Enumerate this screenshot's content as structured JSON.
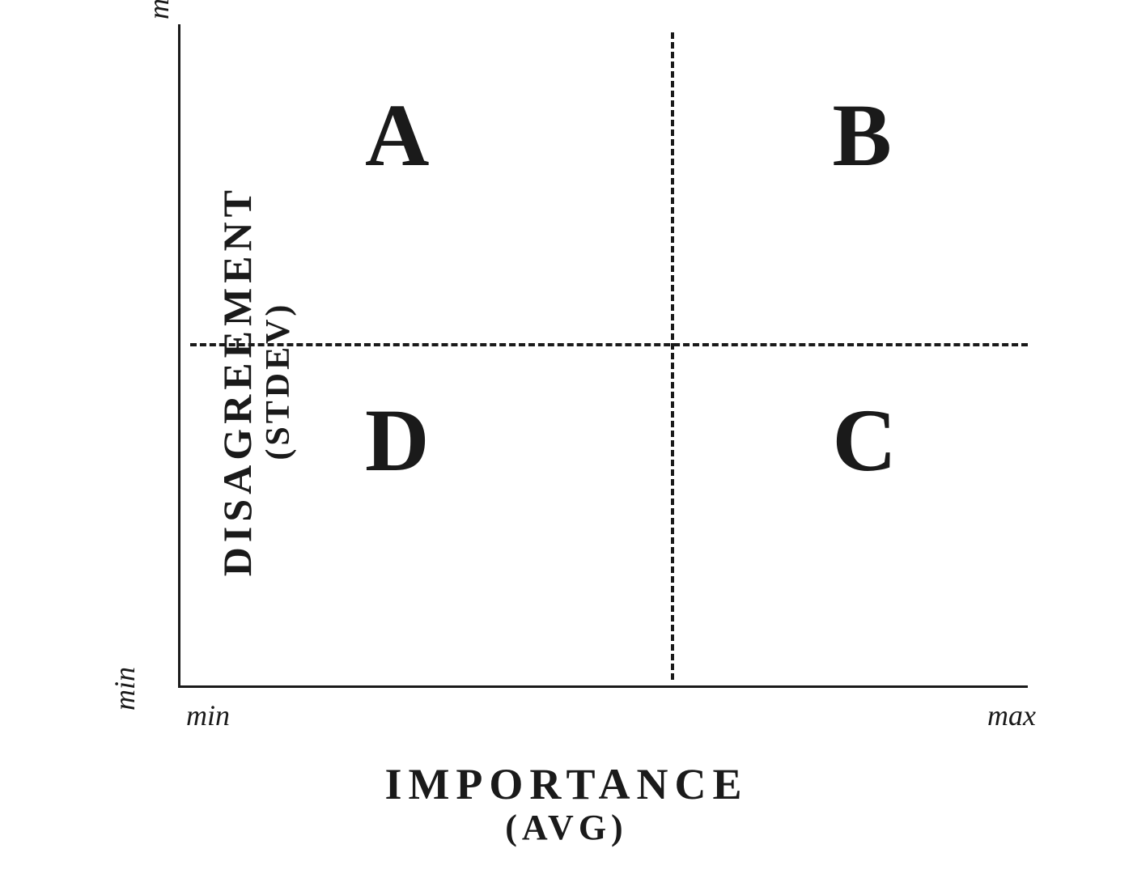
{
  "chart_data": {
    "type": "quadrant",
    "xlabel": "IMPORTANCE",
    "xlabel_sub": "(AVG)",
    "ylabel": "DISAGREEMENT",
    "ylabel_sub": "(STDEV)",
    "x_ticks": {
      "min": "min",
      "max": "max"
    },
    "y_ticks": {
      "min": "min",
      "max": "max"
    },
    "quadrants": {
      "top_left": "A",
      "top_right": "B",
      "bottom_right": "C",
      "bottom_left": "D"
    }
  }
}
